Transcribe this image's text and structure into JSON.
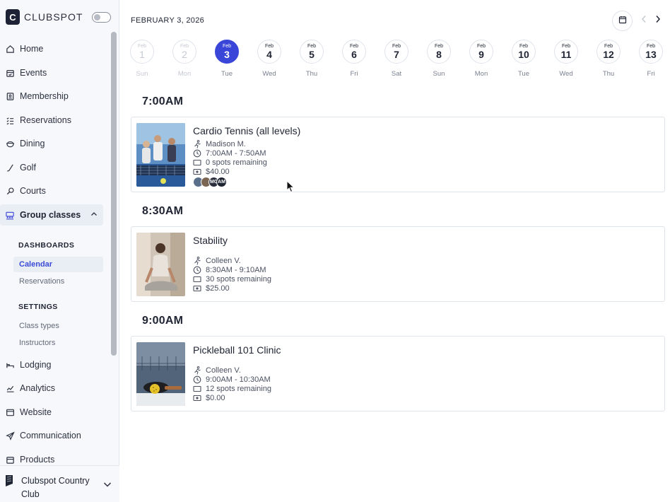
{
  "brand": {
    "logo_letter": "C",
    "name": "CLUBSPOT"
  },
  "sidebar": {
    "items": [
      {
        "label": "Home",
        "icon": "home-icon"
      },
      {
        "label": "Events",
        "icon": "calendar-check-icon"
      },
      {
        "label": "Membership",
        "icon": "id-card-icon"
      },
      {
        "label": "Reservations",
        "icon": "list-icon"
      },
      {
        "label": "Dining",
        "icon": "bowl-icon"
      },
      {
        "label": "Golf",
        "icon": "golf-club-icon"
      },
      {
        "label": "Courts",
        "icon": "racket-icon"
      },
      {
        "label": "Group classes",
        "icon": "group-icon",
        "active": true
      },
      {
        "label": "Lodging",
        "icon": "bed-icon"
      },
      {
        "label": "Analytics",
        "icon": "chart-icon"
      },
      {
        "label": "Website",
        "icon": "browser-icon"
      },
      {
        "label": "Communication",
        "icon": "send-icon"
      },
      {
        "label": "Products",
        "icon": "box-icon"
      }
    ],
    "sub_sections": [
      {
        "heading": "DASHBOARDS",
        "items": [
          "Calendar",
          "Reservations"
        ]
      },
      {
        "heading": "SETTINGS",
        "items": [
          "Class types",
          "Instructors"
        ]
      }
    ],
    "current_sub_item": "Calendar",
    "club_name": "Clubspot Country Club"
  },
  "header": {
    "date_title": "FEBRUARY 3, 2026"
  },
  "days": [
    {
      "month": "Feb",
      "num": "1",
      "weekday": "Sun",
      "state": "past"
    },
    {
      "month": "Feb",
      "num": "2",
      "weekday": "Mon",
      "state": "past"
    },
    {
      "month": "Feb",
      "num": "3",
      "weekday": "Tue",
      "state": "selected"
    },
    {
      "month": "Feb",
      "num": "4",
      "weekday": "Wed",
      "state": "future"
    },
    {
      "month": "Feb",
      "num": "5",
      "weekday": "Thu",
      "state": "future"
    },
    {
      "month": "Feb",
      "num": "6",
      "weekday": "Fri",
      "state": "future"
    },
    {
      "month": "Feb",
      "num": "7",
      "weekday": "Sat",
      "state": "future"
    },
    {
      "month": "Feb",
      "num": "8",
      "weekday": "Sun",
      "state": "future"
    },
    {
      "month": "Feb",
      "num": "9",
      "weekday": "Mon",
      "state": "future"
    },
    {
      "month": "Feb",
      "num": "10",
      "weekday": "Tue",
      "state": "future"
    },
    {
      "month": "Feb",
      "num": "11",
      "weekday": "Wed",
      "state": "future"
    },
    {
      "month": "Feb",
      "num": "12",
      "weekday": "Thu",
      "state": "future"
    },
    {
      "month": "Feb",
      "num": "13",
      "weekday": "Fri",
      "state": "future"
    }
  ],
  "slots": [
    {
      "time": "7:00AM",
      "class": {
        "title": "Cardio Tennis (all levels)",
        "instructor": "Madison M.",
        "time_range": "7:00AM - 7:50AM",
        "spots": "0 spots remaining",
        "price": "$40.00",
        "attendees": [
          {
            "initials": "",
            "color": "#5a6f8a"
          },
          {
            "initials": "",
            "color": "#7a6652"
          },
          {
            "initials": "MC",
            "color": "#2b2f3d"
          },
          {
            "initials": "AM",
            "color": "#1f2433"
          }
        ]
      }
    },
    {
      "time": "8:30AM",
      "class": {
        "title": "Stability",
        "instructor": "Colleen V.",
        "time_range": "8:30AM - 9:10AM",
        "spots": "30 spots remaining",
        "price": "$25.00",
        "attendees": []
      }
    },
    {
      "time": "9:00AM",
      "class": {
        "title": "Pickleball 101 Clinic",
        "instructor": "Colleen V.",
        "time_range": "9:00AM - 10:30AM",
        "spots": "12 spots remaining",
        "price": "$0.00",
        "attendees": []
      }
    }
  ],
  "colors": {
    "accent": "#3a46d8",
    "text": "#1f2433",
    "muted": "#7b8190",
    "border": "#dfe3ea"
  }
}
